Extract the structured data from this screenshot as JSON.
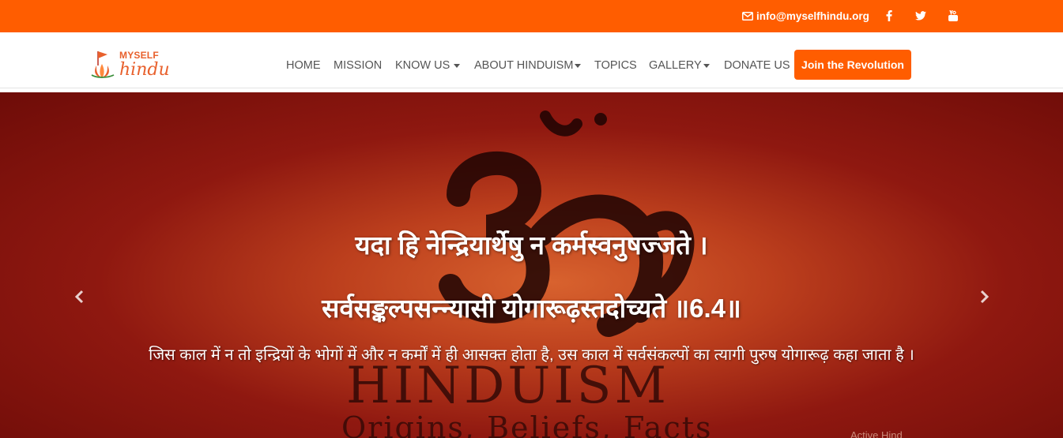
{
  "topbar": {
    "email": "info@myselfhindu.org",
    "icons": [
      "envelope-icon",
      "facebook-icon",
      "twitter-icon",
      "youtube-icon"
    ]
  },
  "logo": {
    "line1": "MYSELF",
    "line2": "hindu"
  },
  "nav": {
    "items": [
      {
        "label": "HOME",
        "dropdown": false
      },
      {
        "label": "MISSION",
        "dropdown": false
      },
      {
        "label": "KNOW US",
        "dropdown": true
      },
      {
        "label": "ABOUT HINDUISM",
        "dropdown": true
      },
      {
        "label": "TOPICS",
        "dropdown": false
      },
      {
        "label": "GALLERY",
        "dropdown": true
      },
      {
        "label": "DONATE US",
        "dropdown": false
      }
    ],
    "cta": "Join the Revolution"
  },
  "hero": {
    "bg_word": "HINDUISM",
    "bg_sub": "Origins, Beliefs, Facts",
    "bg_credit": "Active Hind",
    "verse_line1": "यदा हि नेन्द्रियार्थेषु न कर्मस्वनुषज्जते ।",
    "verse_line2": "सर्वसङ्कल्पसन्न्यासी योगारूढ़स्तदोच्यते ॥6.4॥",
    "meaning": "जिस काल में न तो इन्द्रियों के भोगों में और न कर्मों में ही आसक्त होता है, उस काल में सर्वसंकल्पों का त्यागी पुरुष योगारूढ़ कहा जाता है ।"
  },
  "colors": {
    "accent": "#ff5d00",
    "nav_text": "#555555",
    "hero_red": "#8f1810"
  }
}
